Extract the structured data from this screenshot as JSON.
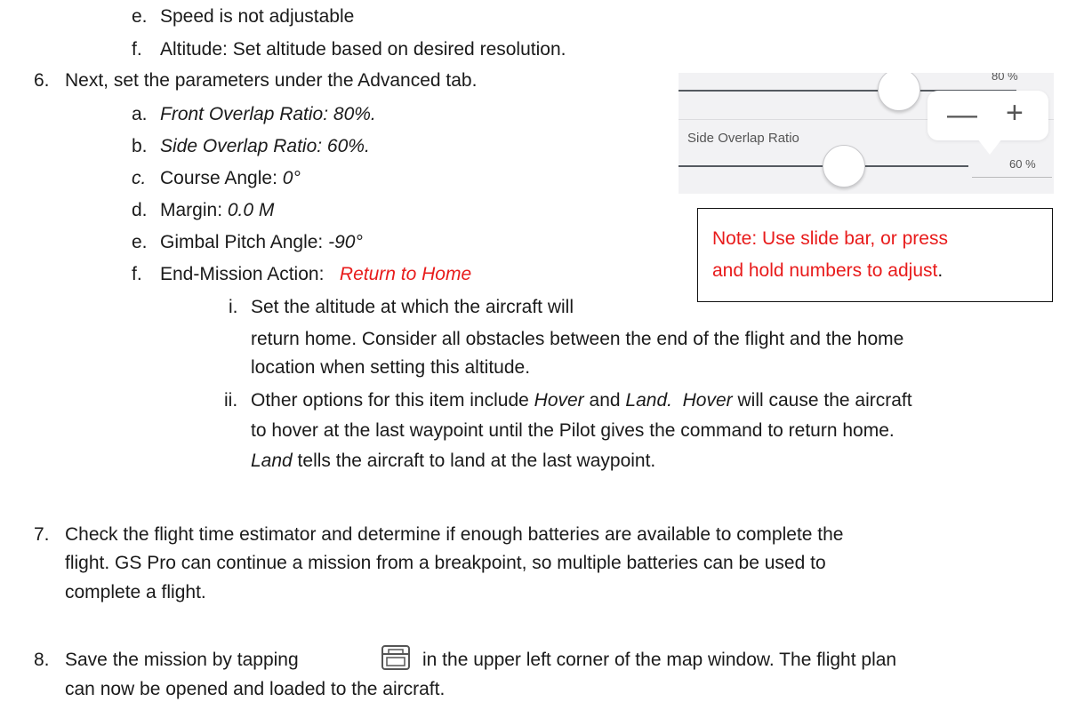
{
  "items": {
    "e_speed": {
      "num": "e.",
      "text": "Speed is not adjustable"
    },
    "f_altitude": {
      "num": "f.",
      "text": "Altitude:  Set altitude based on desired resolution."
    },
    "step6": {
      "num": "6.",
      "text": "Next, set the parameters under the Advanced tab."
    },
    "a": {
      "num": "a.",
      "text": "Front Overlap Ratio: 80%."
    },
    "b": {
      "num": "b.",
      "text": "Side Overlap Ratio: 60%."
    },
    "c": {
      "num": "c.",
      "label": "Course Angle: ",
      "value": "0°"
    },
    "d": {
      "num": "d.",
      "label": "Margin: ",
      "value": "0.0 M"
    },
    "e": {
      "num": "e.",
      "label": "Gimbal Pitch Angle: ",
      "value": "-90°"
    },
    "f": {
      "num": "f.",
      "label": "End-Mission Action:   ",
      "value": "Return to Home"
    },
    "i": {
      "num": "i.",
      "line1": "Set the altitude at which the aircraft will",
      "line2": "return home.  Consider all obstacles between the end of the flight and the home",
      "line3": "location when setting this altitude."
    },
    "ii": {
      "num": "ii.",
      "p1": "Other options for this item include ",
      "hover": "Hover",
      "p2": " and ",
      "land": "Land.",
      "p3": "  ",
      "hover2": "Hover",
      "p4": " will cause the aircraft",
      "line2": "to hover at the last waypoint until the Pilot gives the command to return home.",
      "land2": "Land",
      "line3": " tells the aircraft to land at the last waypoint."
    },
    "step7": {
      "num": "7.",
      "line1": "Check the flight time estimator and determine if enough batteries are available to complete the",
      "line2": "flight.  GS Pro can continue a mission from a breakpoint, so multiple batteries can be used to",
      "line3": "complete a flight."
    },
    "step8": {
      "num": "8.",
      "p1": "Save the mission by tapping",
      "p2": "in the upper left corner of the map window.  The flight plan",
      "line2": "can now be opened and loaded to the aircraft."
    }
  },
  "screenshot": {
    "top_pct": "80 %",
    "label": "Side Overlap Ratio",
    "bottom_pct": "60 %",
    "minus": "—",
    "plus": "+",
    "front_slider_value": 0.8,
    "side_slider_value": 0.6
  },
  "note": {
    "line1": "Note: Use slide bar, or press",
    "line2": "and hold numbers to adjust",
    "line2_end": "."
  },
  "icons": {
    "save": "save-icon"
  }
}
